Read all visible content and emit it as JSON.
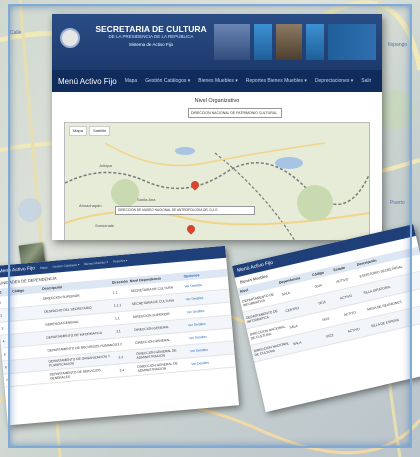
{
  "header": {
    "line1": "SECRETARIA DE CULTURA",
    "line2": "DE LA PRESIDENCIA DE LA REPÚBLICA",
    "line3": "Sistema de Activo Fijo"
  },
  "nav": {
    "brand": "Menú Activo Fijo",
    "items": [
      "Mapa",
      "Gestión Catálogos ▾",
      "Bienes Muebles ▾",
      "Reportes Bienes Muebles ▾",
      "Depreciaciones ▾",
      "Salir"
    ]
  },
  "content": {
    "level_label": "Nivel Organizativo",
    "selected_unit": "DIRECCION NACIONAL DE PATRIMONIO CULTURAL",
    "map_tabs": [
      "Mapa",
      "Satélite"
    ],
    "address_input": "DIRECCION DE MUSEO NACIONAL DE ANTROPOLOGIA DR. D.J.G",
    "places": [
      "Jutiapa",
      "Santa Ana",
      "Ahuachapán",
      "Sonsonate"
    ]
  },
  "list_left": {
    "brand": "Menú Activo Fijo",
    "nav_items": [
      "Mapa",
      "Gestión Catálogos ▾",
      "Bienes Muebles ▾",
      "Reportes ▾"
    ],
    "subtitle": "UNIDADES DE DEPENDENCIA",
    "columns": [
      "Id",
      "Código",
      "Descripción",
      "Dirección",
      "Nivel Dependencia",
      "Opciones"
    ],
    "rows": [
      [
        "1",
        "",
        "DIRECCION SUPERIOR",
        "1.1",
        "SECRETARIA DE CULTURA",
        "Ver Detalles"
      ],
      [
        "2",
        "",
        "DESPACHO DEL SECRETARIO",
        "1.1.1",
        "SECRETARIA DE CULTURA",
        "Ver Detalles"
      ],
      [
        "3",
        "",
        "GERENCIA GENERAL",
        "1.1",
        "DIRECCION SUPERIOR",
        "Ver Detalles"
      ],
      [
        "4",
        "",
        "DEPARTAMENTO DE INFORMATICA",
        "3.1",
        "DIRECCION GENERAL",
        "Ver Detalles"
      ],
      [
        "5",
        "",
        "DEPARTAMENTO DE RECURSOS HUMANOS",
        "3.2",
        "DIRECCION GENERAL",
        "Ver Detalles"
      ],
      [
        "6",
        "",
        "DEPARTAMENTO DE ORGANIZACION Y PLANIFICACION",
        "3.3",
        "DIRECCION GENERAL DE ADMINISTRACION",
        "Ver Detalles"
      ],
      [
        "7",
        "",
        "DEPARTAMENTO DE SERVICIOS GENERALES",
        "3.4",
        "DIRECCION GENERAL DE ADMINISTRACION",
        "Ver Detalles"
      ]
    ]
  },
  "list_right": {
    "brand": "Menú Activo Fijo",
    "subtitle": "Bienes Muebles",
    "columns": [
      "Nivel",
      "Dependencia",
      "Código",
      "Estado",
      "Descripción"
    ],
    "rows": [
      [
        "DEPARTAMENTO DE INFORMATICA",
        "SALA",
        "0014",
        "ACTIVO",
        "ESCRITORIO SECRETARIAL"
      ],
      [
        "DEPARTAMENTO DE INFORMATICA",
        "CENTRO",
        "0015",
        "ACTIVO",
        "SILLA GIRATORIA"
      ],
      [
        "DIRECCION NACIONAL DE CULTURA",
        "SALA",
        "0021",
        "ACTIVO",
        "MESA DE REUNIONES"
      ],
      [
        "DIRECCION NACIONAL DE CULTURA",
        "SALA",
        "0022",
        "ACTIVO",
        "SILLA DE ESPERA"
      ]
    ]
  },
  "side_texts": [
    "Ilopango",
    "Calle",
    "Puerto"
  ],
  "colors": {
    "header_blue": "#1d3a6c",
    "nav_blue": "#0f2c5c",
    "pin_red": "#d44632",
    "frame_blue": "#7fa9d6"
  }
}
